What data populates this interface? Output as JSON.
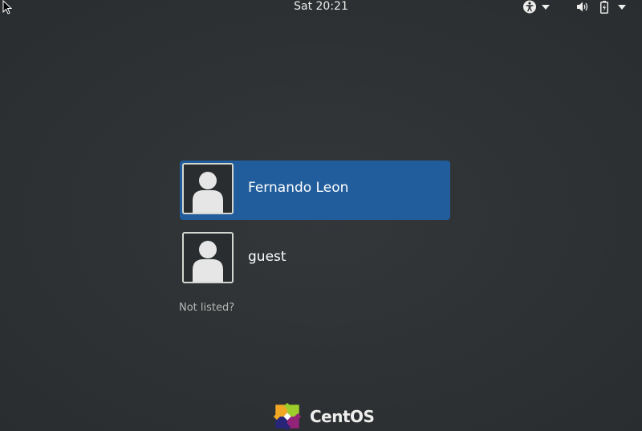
{
  "topbar": {
    "clock": "Sat 20:21",
    "icons": {
      "accessibility": "accessibility-icon",
      "volume": "volume-icon",
      "battery": "battery-charging-icon",
      "menu": "chevron-down-icon"
    }
  },
  "users": [
    {
      "name": "Fernando Leon",
      "selected": true,
      "avatar": "user-avatar-icon"
    },
    {
      "name": "guest",
      "selected": false,
      "avatar": "user-avatar-icon"
    }
  ],
  "not_listed_label": "Not listed?",
  "logo": {
    "text": "CentOS",
    "icon": "centos-logo-icon"
  },
  "colors": {
    "background": "#2e3234",
    "selected_row": "#215d9c",
    "text": "#eeeeec",
    "muted_text": "#b6b8b4"
  }
}
